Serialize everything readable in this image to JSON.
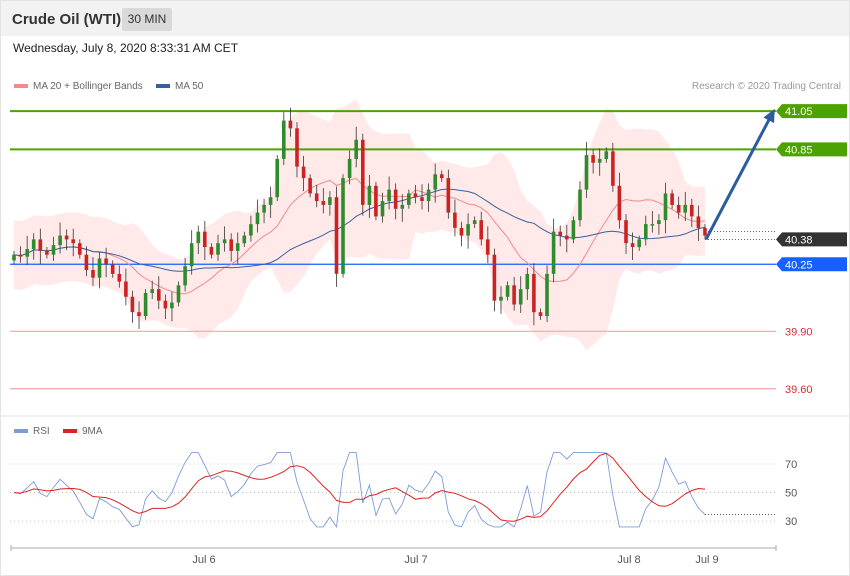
{
  "header": {
    "title": "Crude Oil (WTI)",
    "timeframe": "30 MIN"
  },
  "timestamp": "Wednesday, July 8, 2020 8:33:31 AM CET",
  "legend": {
    "ma20": "MA 20 + Bollinger Bands",
    "ma50": "MA 50",
    "credit": "Research © 2020 Trading Central"
  },
  "rsi_legend": {
    "rsi": "RSI",
    "ma9": "9MA"
  },
  "colors": {
    "ma20": "#f28a8a",
    "ma50": "#3b5f9e",
    "resistance": "#4ca300",
    "support": "#1560ff",
    "current": "#333333",
    "lower_support": "#e07070",
    "band": "#ffe4e4",
    "up": "#2e8b2e",
    "down": "#cc2222",
    "arrow": "#2b5c9e",
    "rsi": "#7b9bd9",
    "rsi_ma": "#e02020"
  },
  "chart_data": {
    "type": "candlestick",
    "x_labels": [
      "Jul 6",
      "Jul 7",
      "Jul 8",
      "Jul 9"
    ],
    "price_range": [
      39.51,
      41.16
    ],
    "levels": [
      {
        "name": "resistance-2",
        "value": 41.05,
        "label": "41.05",
        "kind": "resistance"
      },
      {
        "name": "resistance-1",
        "value": 40.85,
        "label": "40.85",
        "kind": "resistance"
      },
      {
        "name": "current",
        "value": 40.38,
        "label": "40.38",
        "kind": "current"
      },
      {
        "name": "support-1",
        "value": 40.25,
        "label": "40.25",
        "kind": "support"
      },
      {
        "name": "support-2",
        "value": 39.9,
        "label": "39.90",
        "kind": "lower"
      },
      {
        "name": "support-3",
        "value": 39.6,
        "label": "39.60",
        "kind": "lower"
      }
    ],
    "projection": {
      "from": 40.38,
      "to": 41.05
    },
    "closes": [
      40.3,
      40.29,
      40.33,
      40.38,
      40.32,
      40.3,
      40.35,
      40.4,
      40.38,
      40.36,
      40.3,
      40.22,
      40.18,
      40.28,
      40.25,
      40.2,
      40.16,
      40.08,
      40.0,
      39.98,
      40.1,
      40.12,
      40.06,
      40.02,
      40.05,
      40.14,
      40.24,
      40.36,
      40.42,
      40.34,
      40.3,
      40.36,
      40.38,
      40.32,
      40.36,
      40.4,
      40.46,
      40.52,
      40.56,
      40.6,
      40.8,
      41.0,
      40.96,
      40.76,
      40.7,
      40.62,
      40.58,
      40.56,
      40.6,
      40.2,
      40.7,
      40.8,
      40.9,
      40.56,
      40.66,
      40.5,
      40.58,
      40.64,
      40.54,
      40.56,
      40.62,
      40.6,
      40.58,
      40.64,
      40.72,
      40.7,
      40.52,
      40.44,
      40.4,
      40.46,
      40.48,
      40.38,
      40.3,
      40.06,
      40.08,
      40.14,
      40.04,
      40.12,
      40.2,
      40.0,
      39.98,
      40.2,
      40.42,
      40.4,
      40.38,
      40.48,
      40.64,
      40.82,
      40.78,
      40.8,
      40.84,
      40.66,
      40.48,
      40.36,
      40.34,
      40.38,
      40.46,
      40.46,
      40.48,
      40.62,
      40.56,
      40.52,
      40.56,
      40.5,
      40.44,
      40.4
    ],
    "rsi": {
      "levels": [
        70,
        50,
        30
      ],
      "range": [
        14,
        84
      ]
    }
  }
}
